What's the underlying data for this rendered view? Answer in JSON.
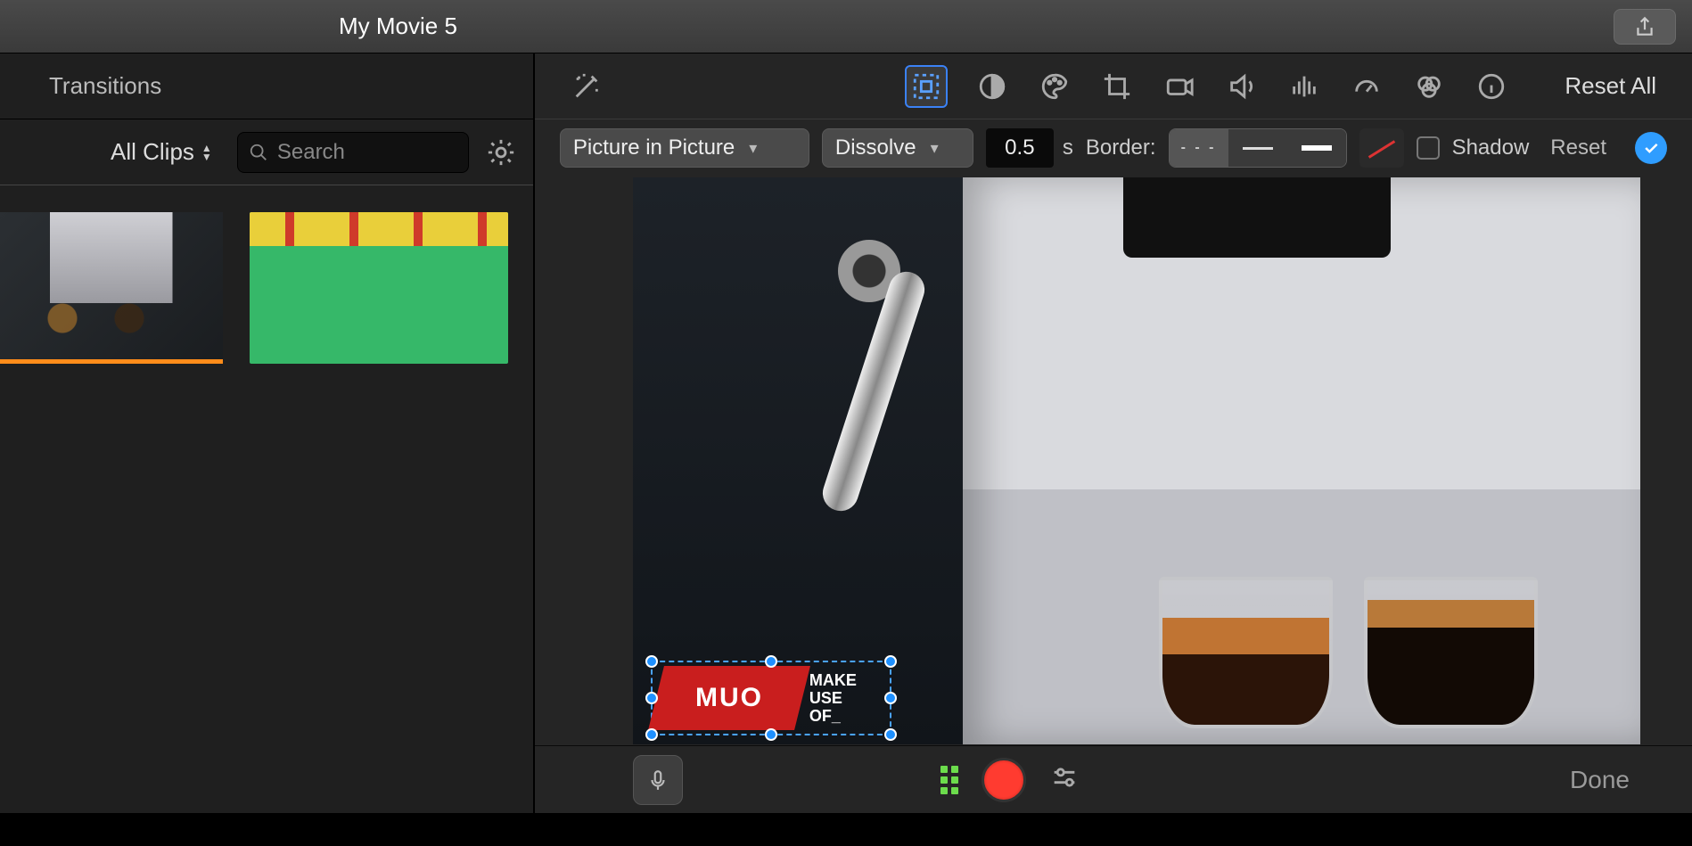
{
  "title": "My Movie 5",
  "left": {
    "tab": "Transitions",
    "clips_filter": "All Clips",
    "search_placeholder": "Search"
  },
  "toolbar": {
    "reset_all": "Reset All"
  },
  "pip": {
    "mode": "Picture in Picture",
    "transition": "Dissolve",
    "duration": "0.5",
    "duration_unit_suffix": "s",
    "border_label": "Border:",
    "border_style": "none",
    "border_styles": [
      "dotted",
      "thin",
      "thick"
    ],
    "shadow_label": "Shadow",
    "shadow_checked": false,
    "reset_label": "Reset",
    "applied": true
  },
  "overlay": {
    "badge_text": "MUO",
    "line1": "MAKE",
    "line2": "USE",
    "line3": "OF_"
  },
  "bottom": {
    "done": "Done"
  }
}
